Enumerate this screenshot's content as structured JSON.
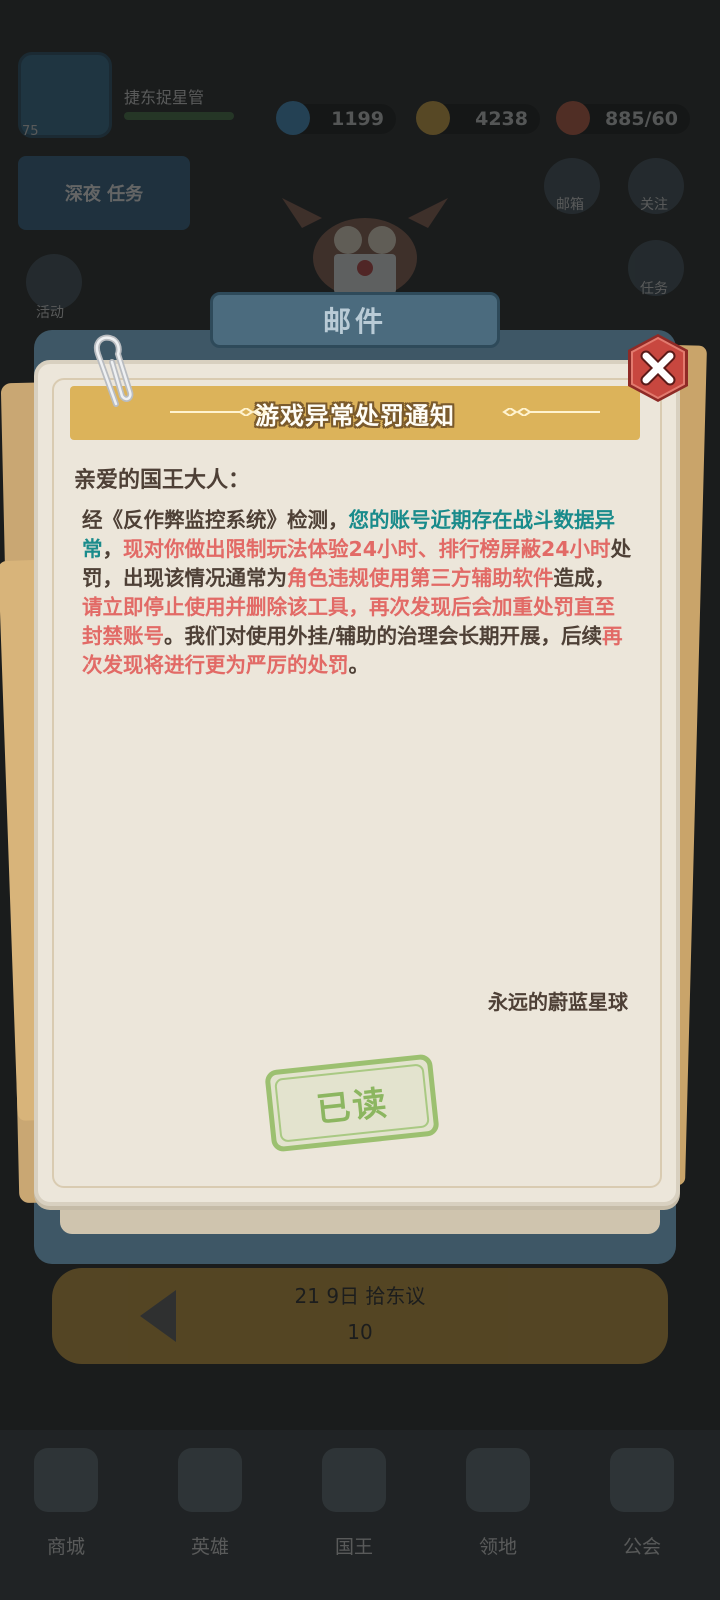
{
  "background": {
    "player": {
      "name": "捷东捉星管",
      "level": "75"
    },
    "resources": [
      {
        "name": "diamonds",
        "value": "1199"
      },
      {
        "name": "coins",
        "value": "4238"
      },
      {
        "name": "stamina",
        "value": "885/60"
      }
    ],
    "event_banner": "深夜 任务",
    "side_icons": [
      {
        "label": "邮箱"
      },
      {
        "label": "关注"
      },
      {
        "label": "任务"
      },
      {
        "label": "活动"
      }
    ],
    "strip_text": "21 9日 拾东议",
    "strip_subtext": "10",
    "bottom_nav": [
      {
        "label": "商城"
      },
      {
        "label": "英雄"
      },
      {
        "label": "国王"
      },
      {
        "label": "领地"
      },
      {
        "label": "公会"
      }
    ]
  },
  "mail": {
    "header_title": "邮件",
    "notice_title": "游戏异常处罚通知",
    "greeting": "亲爱的国王大人：",
    "body": {
      "p1": "经《反作弊监控系统》检测，",
      "p2": "您的账号近期存在战斗数据异常",
      "p3": "，",
      "p4": "现对你做出限制玩法体验24小时、排行榜屏蔽24小时",
      "p5": "处罚，出现该情况通常为",
      "p6": "角色违规使用第三方辅助软件",
      "p7": "造成，",
      "p8": "请立即停止使用并删除该工具，再次发现后会加重处罚直至封禁账号",
      "p9": "。我们对使用外挂/辅助的治理会长期开展，后续",
      "p10": "再次发现将进行更为严厉的处罚",
      "p11": "。"
    },
    "signature": "永远的蔚蓝星球",
    "read_stamp": "已读",
    "colors": {
      "highlight_teal": "#198b8b",
      "highlight_red": "#e26a66",
      "text": "#4e4036",
      "banner": "#dcb35a",
      "close_button": "#c8473f"
    }
  }
}
